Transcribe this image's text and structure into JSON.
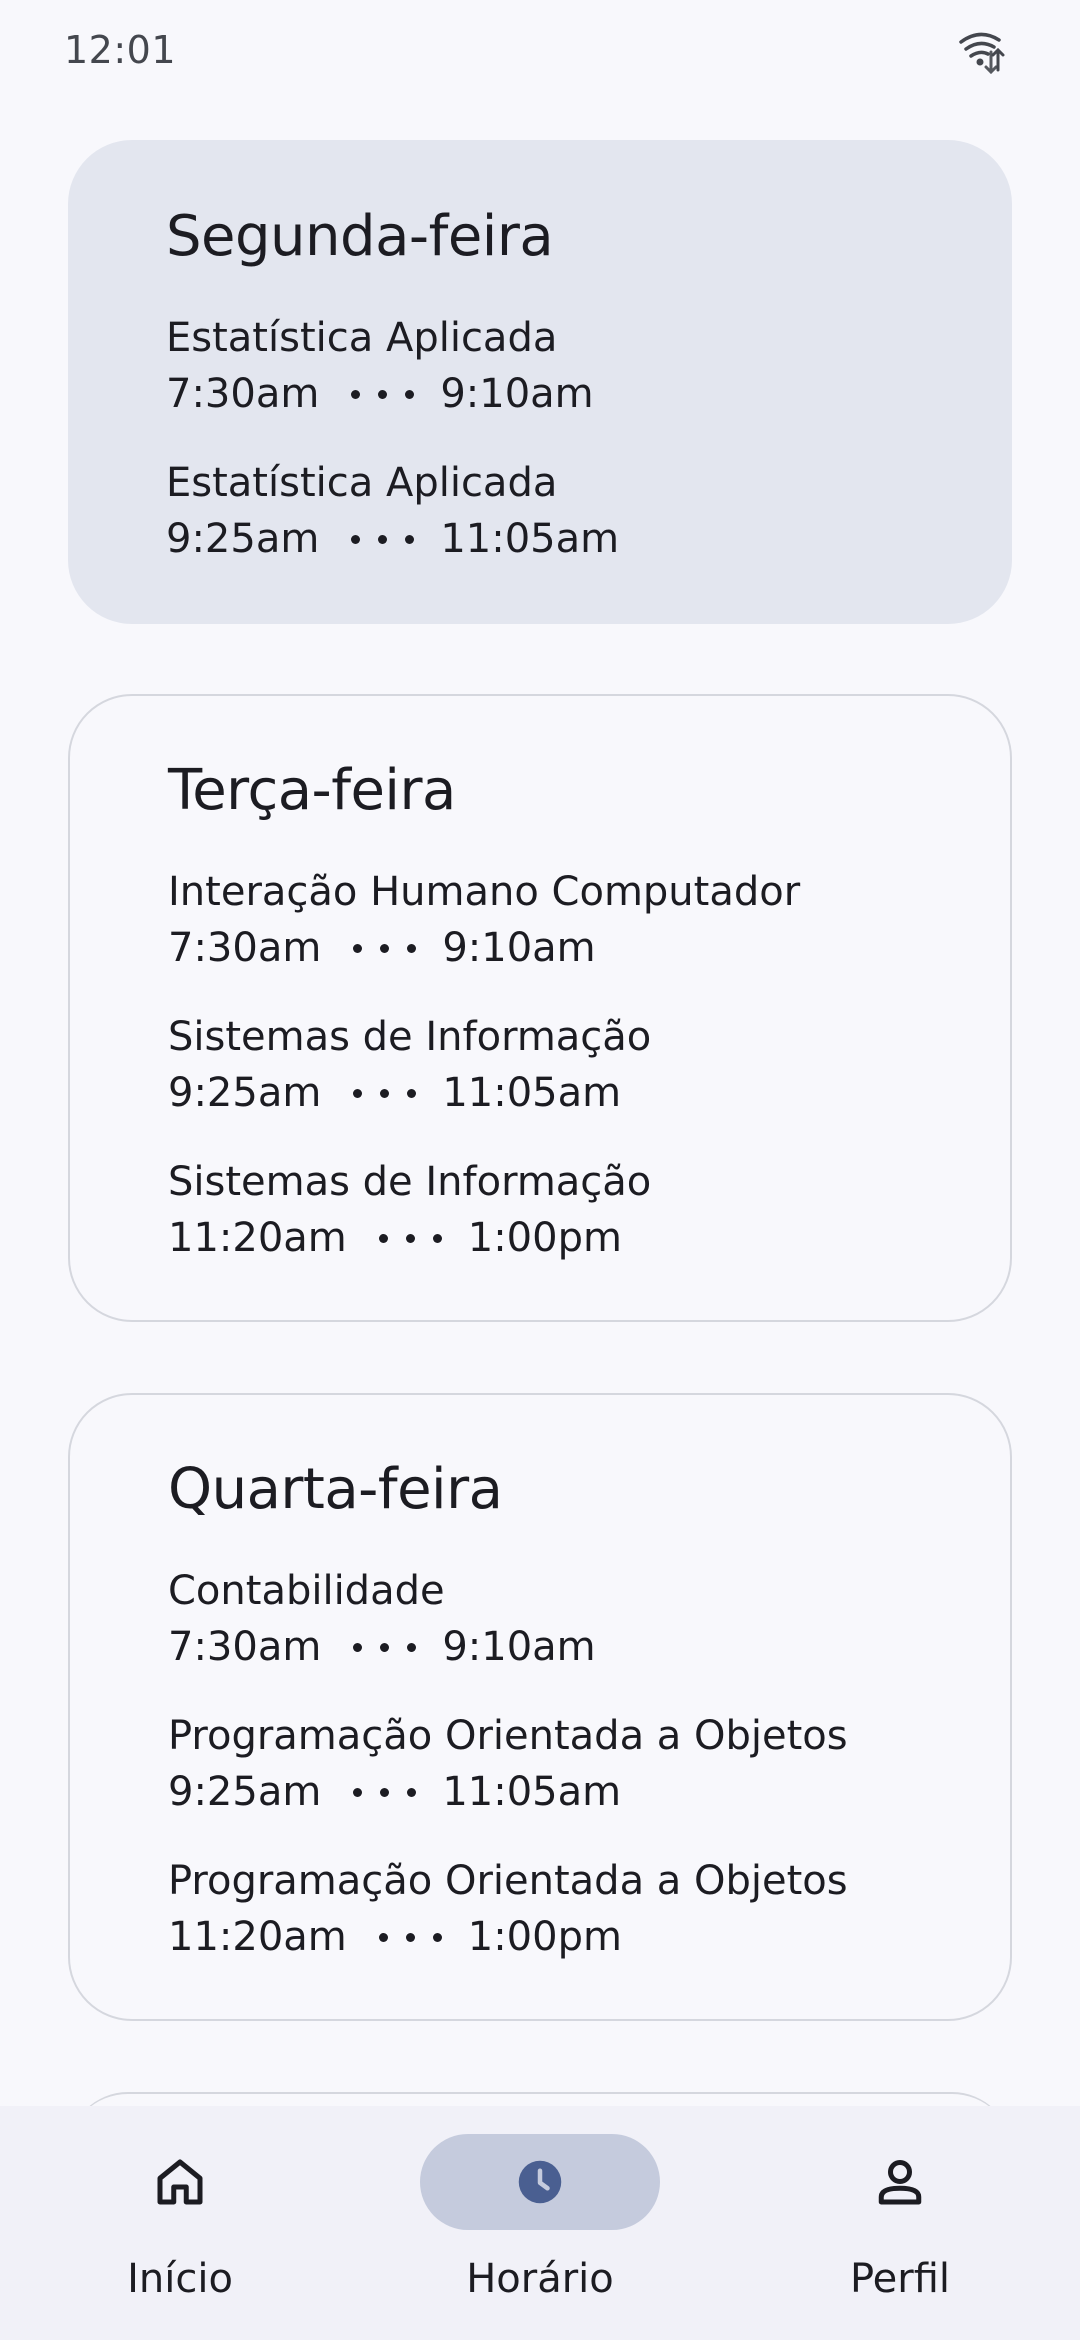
{
  "status": {
    "time": "12:01",
    "network_icon": "wifi-data-icon"
  },
  "schedule": [
    {
      "day": "Segunda-feira",
      "highlighted": true,
      "classes": [
        {
          "name": "Estatística Aplicada",
          "start": "7:30am",
          "end": "9:10am"
        },
        {
          "name": "Estatística Aplicada",
          "start": "9:25am",
          "end": "11:05am"
        }
      ]
    },
    {
      "day": "Terça-feira",
      "highlighted": false,
      "classes": [
        {
          "name": "Interação Humano Computador",
          "start": "7:30am",
          "end": "9:10am"
        },
        {
          "name": "Sistemas de Informação",
          "start": "9:25am",
          "end": "11:05am"
        },
        {
          "name": "Sistemas de Informação",
          "start": "11:20am",
          "end": "1:00pm"
        }
      ]
    },
    {
      "day": "Quarta-feira",
      "highlighted": false,
      "classes": [
        {
          "name": "Contabilidade",
          "start": "7:30am",
          "end": "9:10am"
        },
        {
          "name": "Programação Orientada a Objetos",
          "start": "9:25am",
          "end": "11:05am"
        },
        {
          "name": "Programação Orientada a Objetos",
          "start": "11:20am",
          "end": "1:00pm"
        }
      ]
    }
  ],
  "nav": {
    "items": [
      {
        "label": "Início",
        "icon": "home-icon",
        "active": false
      },
      {
        "label": "Horário",
        "icon": "clock-icon",
        "active": true
      },
      {
        "label": "Perfil",
        "icon": "person-icon",
        "active": false
      }
    ]
  },
  "colors": {
    "accent": "#4a5f91",
    "active_pill": "#c5cbdd",
    "card_highlight": "#e3e6ef"
  }
}
